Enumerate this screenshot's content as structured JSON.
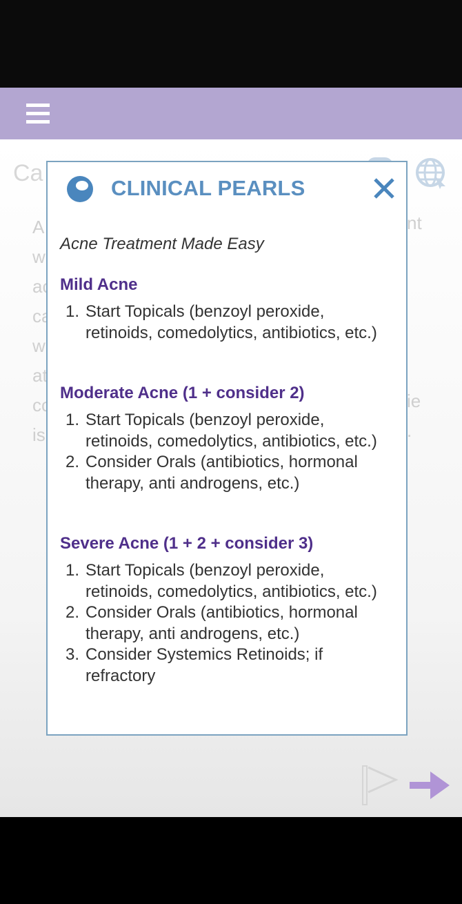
{
  "header": {
    "menu_icon": "hamburger-menu-icon"
  },
  "background": {
    "title_fragment": "Ca",
    "para_left": [
      "A",
      "w",
      "ac",
      "ca",
      "w",
      "at",
      "cc",
      "is"
    ],
    "para_right_1": "nt",
    "para_right_2": "ie",
    "para_right_3": "."
  },
  "modal": {
    "icon": "pearl-icon",
    "title": "CLINICAL PEARLS",
    "close_icon": "close-icon",
    "subtitle": "Acne Treatment Made Easy",
    "sections": [
      {
        "title": "Mild Acne",
        "items": [
          "Start Topicals (benzoyl peroxide, retinoids, comedolytics, antibiotics, etc.)"
        ]
      },
      {
        "title": "Moderate Acne (1 + consider 2)",
        "items": [
          "Start Topicals (benzoyl peroxide, retinoids, comedolytics, antibiotics, etc.)",
          "Consider Orals (antibiotics, hormonal therapy, anti androgens, etc.)"
        ]
      },
      {
        "title": "Severe Acne (1 + 2 + consider 3)",
        "items": [
          "Start Topicals (benzoyl peroxide, retinoids, comedolytics, antibiotics, etc.)",
          "Consider Orals (antibiotics, hormonal therapy, anti androgens, etc.)",
          "Consider Systemics Retinoids; if refractory"
        ]
      }
    ]
  },
  "footer": {
    "flag_icon": "flag-icon",
    "next_icon": "next-arrow-icon"
  },
  "colors": {
    "header": "#b3a6d1",
    "title": "#5a8fc0",
    "section": "#4f2f8a",
    "accent": "#b094d6"
  }
}
